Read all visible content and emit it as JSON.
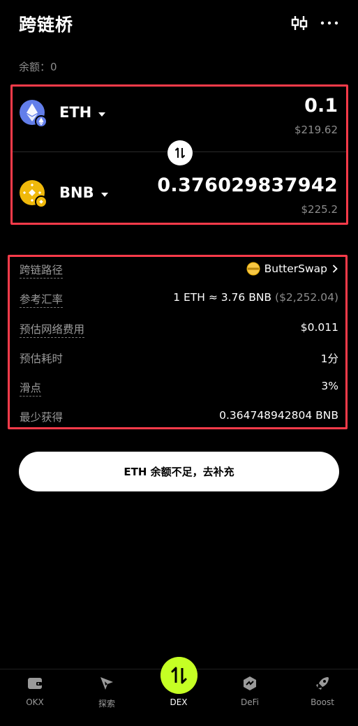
{
  "header": {
    "title": "跨链桥"
  },
  "balance": {
    "label": "余额：",
    "value": "0"
  },
  "swap": {
    "from": {
      "symbol": "ETH",
      "amount": "0.1",
      "usd": "$219.62"
    },
    "to": {
      "symbol": "BNB",
      "amount": "0.376029837942",
      "usd": "$225.2"
    }
  },
  "details": {
    "route_label": "跨链路径",
    "route_value": "ButterSwap",
    "rate_label": "参考汇率",
    "rate_value": "1 ETH ≈ 3.76 BNB",
    "rate_usd": "($2,252.04)",
    "fee_label": "预估网络费用",
    "fee_value": "$0.011",
    "time_label": "预估耗时",
    "time_value": "1分",
    "slippage_label": "滑点",
    "slippage_value": "3%",
    "min_label": "最少获得",
    "min_value": "0.364748942804 BNB"
  },
  "action": {
    "label": "ETH 余额不足，去补充"
  },
  "nav": {
    "items": [
      {
        "label": "OKX",
        "icon": "wallet-icon"
      },
      {
        "label": "探索",
        "icon": "compass-icon"
      },
      {
        "label": "DEX",
        "icon": "swap-icon"
      },
      {
        "label": "DeFi",
        "icon": "defi-icon"
      },
      {
        "label": "Boost",
        "icon": "rocket-icon"
      }
    ]
  },
  "colors": {
    "accent": "#c5ff24",
    "highlight_border": "#ff3b4a",
    "eth": "#627eea",
    "bnb": "#f0b90b"
  }
}
